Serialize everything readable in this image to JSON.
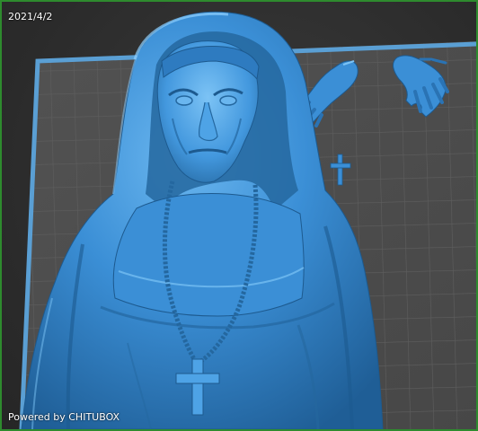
{
  "viewport": {
    "date_label": "2021/4/2",
    "brand_label": "Powered by CHITUBOX"
  },
  "colors": {
    "frame_border": "#2e8b2e",
    "plate_fill": "#4a4a4a",
    "plate_grid": "#5c5c5c",
    "plate_edge": "#5a9fd4",
    "model_fill": "#3b8fd6",
    "model_highlight": "#7cc3f5",
    "model_shadow": "#1d5a8f"
  },
  "scene": {
    "objects": [
      "nun-bust-model",
      "left-hand-model",
      "right-hand-model",
      "cross-model"
    ]
  }
}
